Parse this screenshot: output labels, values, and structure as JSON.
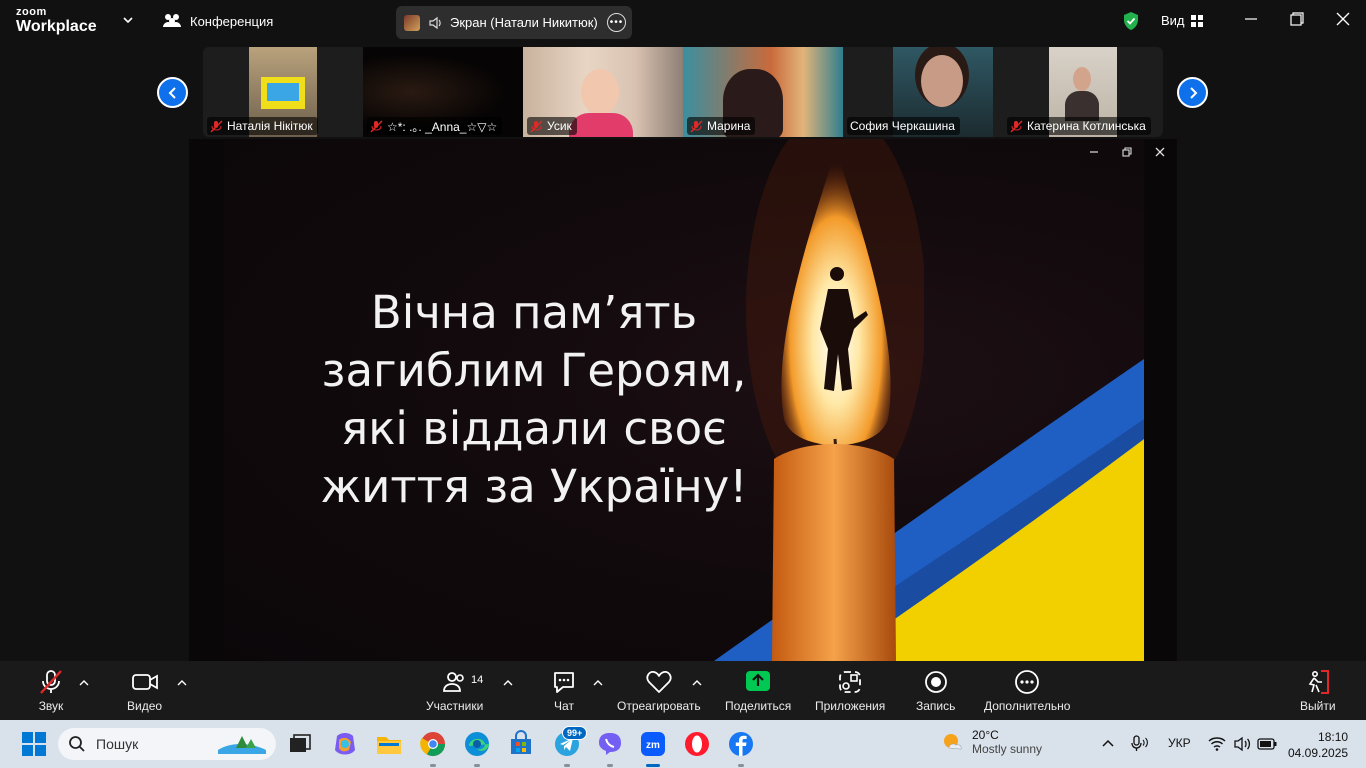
{
  "app": {
    "brand_small": "zoom",
    "brand_large": "Workplace"
  },
  "titlebar": {
    "meeting_label": "Конференция",
    "share_pill_label": "Экран (Натали Никитюк)",
    "view_label": "Вид"
  },
  "participants": [
    {
      "name": "Наталія Нікітюк",
      "muted": true
    },
    {
      "name": "☆*: .｡. _Anna_☆▽☆",
      "muted": true
    },
    {
      "name": "Усик",
      "muted": true
    },
    {
      "name": "Марина",
      "muted": true
    },
    {
      "name": "София Черкашина",
      "muted": false
    },
    {
      "name": "Катерина Котлинська",
      "muted": true
    }
  ],
  "shared_screen": {
    "text_lines": [
      "Вічна пам’ять",
      "загиблим Героям,",
      "які віддали своє",
      "життя за Україну!"
    ]
  },
  "toolbar": {
    "audio_label": "Звук",
    "video_label": "Видео",
    "participants_label": "Участники",
    "participants_count": "14",
    "chat_label": "Чат",
    "react_label": "Отреагировать",
    "share_label": "Поделиться",
    "apps_label": "Приложения",
    "record_label": "Запись",
    "more_label": "Дополнительно",
    "leave_label": "Выйти"
  },
  "taskbar": {
    "search_placeholder": "Пошук",
    "telegram_badge": "99+",
    "weather_temp": "20°C",
    "weather_desc": "Mostly sunny",
    "language": "УКР",
    "time": "18:10",
    "date": "04.09.2025"
  },
  "colors": {
    "accent_blue": "#0e71eb",
    "share_green": "#00c853",
    "mute_red": "#e02828",
    "flag_blue": "#1f5fc4",
    "flag_yellow": "#f2d000"
  }
}
